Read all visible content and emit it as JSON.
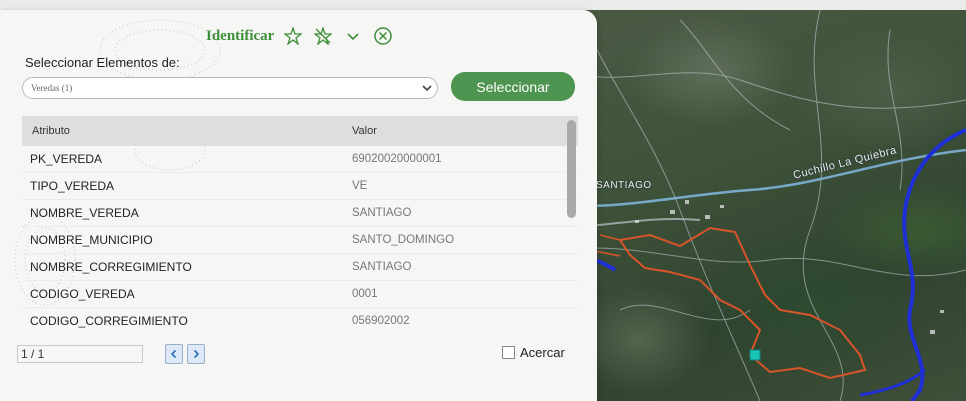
{
  "panel": {
    "title": "Identificar",
    "select_label": "Seleccionar Elementos de:",
    "dropdown_value": "Veredas (1)",
    "select_button": "Seleccionar",
    "table": {
      "headers": [
        "Atributo",
        "Valor"
      ],
      "rows": [
        {
          "attr": "PK_VEREDA",
          "value": "69020020000001"
        },
        {
          "attr": "TIPO_VEREDA",
          "value": "VE"
        },
        {
          "attr": "NOMBRE_VEREDA",
          "value": "SANTIAGO"
        },
        {
          "attr": "NOMBRE_MUNICIPIO",
          "value": "SANTO_DOMINGO"
        },
        {
          "attr": "NOMBRE_CORREGIMIENTO",
          "value": "SANTIAGO"
        },
        {
          "attr": "CODIGO_VEREDA",
          "value": "0001"
        },
        {
          "attr": "CODIGO_CORREGIMIENTO",
          "value": "056902002"
        }
      ]
    },
    "pager_value": "1 / 1",
    "zoom_label": "Acercar"
  },
  "map": {
    "road_label": "Cuchillo La Quiebra",
    "town_label": "SANTIAGO"
  },
  "icons": {
    "pin": "pin-icon",
    "unpin": "unpin-icon",
    "collapse": "chevron-down-icon",
    "close": "close-circle-icon",
    "prev": "chevron-left-icon",
    "next": "chevron-right-icon"
  },
  "colors": {
    "accent_green": "#4d9450",
    "title_green": "#3e8f3a",
    "boundary_orange": "#d8542a",
    "river_blue": "#1f2fd6"
  }
}
